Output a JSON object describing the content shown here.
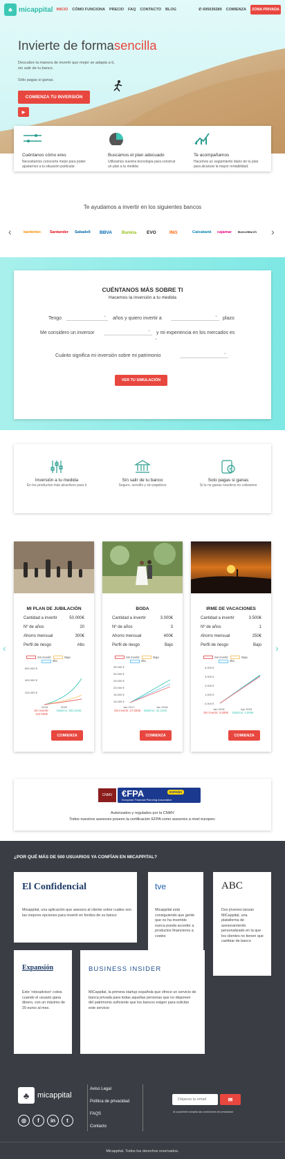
{
  "nav": {
    "logo": "micappital",
    "links": [
      "INICIO",
      "CÓMO FUNCIONA",
      "PRECIO",
      "FAQ",
      "CONTACTO",
      "BLOG"
    ],
    "phone": "695039289",
    "start": "COMIENZA",
    "private": "ZONA PRIVADA"
  },
  "hero": {
    "title_start": "Invierte de forma",
    "title_highlight": "sencilla",
    "subtitle": "Descubre la manera de invertir que mejor se adapta a ti, sin salir de tu banco.",
    "pay": "Sólo pagas si ganas.",
    "cta": "COMIENZA TU INVERSIÓN"
  },
  "features": [
    {
      "title": "Cuéntanos cómo eres",
      "text": "Necesitamos conocerte mejor para poder ajustarnos a tu situación particular."
    },
    {
      "title": "Buscamos el plan adecuado",
      "text": "Utilizamos nuestra tecnología para construir un plan a tu medida"
    },
    {
      "title": "Te acompañamos",
      "text": "Hacemos un seguimiento diario de tu plan para alcanzar la mayor rentabilidad."
    }
  ],
  "banks": {
    "title": "Te ayudamos a invertir en los siguientes bancos",
    "list": [
      "bankinter.",
      "Santander",
      "Sabadell",
      "BBVA",
      "Bankia",
      "EVO",
      "ING",
      "Caixabank",
      "cajamar",
      "BancoMarch"
    ]
  },
  "form": {
    "title": "CUÉNTANOS MÁS SOBRE TI",
    "subtitle": "Hacemos la inversión a tu medida",
    "row1_a": "Tengo",
    "row1_b": "años y quiero invertir a",
    "row1_c": "plazo",
    "row2_a": "Me considero un inversor",
    "row2_b": "y mi experiencia en los mercados es",
    "row3": "Cuánto significa mi inversión sobre mi patrimonio",
    "button": "VER TU SIMULACIÓN"
  },
  "benefits": [
    {
      "title": "Inversión a tu medida",
      "text": "En los productos más atractivos para ti"
    },
    {
      "title": "Sin salir de tu banco",
      "text": "Seguro, sencillo y sin papeleos"
    },
    {
      "title": "Solo pagas si ganas",
      "text": "Si tu no ganas nosotros no cobramos"
    }
  ],
  "plans": [
    {
      "title": "MI PLAN DE JUBILACIÓN",
      "rows": [
        [
          "Cantidad a invertir",
          "50.000€"
        ],
        [
          "Nº de años",
          "20"
        ],
        [
          "Ahorro mensual",
          "300€"
        ],
        [
          "Perfil de riesgo",
          "Alto"
        ]
      ],
      "legend": [
        "Sin invertir",
        "Baja",
        "alta"
      ],
      "ticks_y": [
        "600.000 €",
        "400.000 €",
        "200.000 €"
      ],
      "ticks_x": [
        "2018",
        "2029"
      ],
      "min": "Sin invertir: 122.000€",
      "max": "Máximo: 563.164€",
      "button": "COMIENZA"
    },
    {
      "title": "BODA",
      "rows": [
        [
          "Cantidad a invertir",
          "3.000€"
        ],
        [
          "Nº de años",
          "3"
        ],
        [
          "Ahorro mensual",
          "400€"
        ],
        [
          "Perfil de riesgo",
          "Bajo"
        ]
      ],
      "legend": [
        "Sin invertir",
        "Baja",
        "alta"
      ],
      "ticks_y": [
        "35.000 €",
        "30.000 €",
        "25.000 €",
        "20.000 €",
        "15.000 €",
        "10.000 €"
      ],
      "ticks_x": [
        "Jan 2017",
        "Jan 2018"
      ],
      "min": "Sin invertir: 27.000€",
      "max": "Máximo: 32.210€",
      "button": "COMIENZA"
    },
    {
      "title": "IRME DE VACACIONES",
      "rows": [
        [
          "Cantidad a invertir",
          "3.500€"
        ],
        [
          "Nº de años",
          "1"
        ],
        [
          "Ahorro mensual",
          "250€"
        ],
        [
          "Perfil de riesgo",
          "Bajo"
        ]
      ],
      "legend": [
        "Sin invertir",
        "Baja",
        "alta"
      ],
      "ticks_y": [
        "4.000 €",
        "3.000 €",
        "2.000 €",
        "1.000 €",
        "0.000 €"
      ],
      "ticks_x": [
        "Jan 2018",
        "Apr 2018"
      ],
      "min": "Sin invertir: 3.500€",
      "max": "Máximo: 3.600€",
      "button": "COMIENZA"
    }
  ],
  "efpa": {
    "cnmv": "CNMV",
    "logo": "€FPA",
    "espana": "ESPAÑA",
    "assoc": "European Financial Planning Association",
    "line1": "Autorizados y regulados por la CNMV",
    "line2": "Todos nuestros asesores poseen la certificación EFPA como asesores a nivel europeo."
  },
  "press": {
    "title": "¿POR QUÉ MÁS DE 500 USUARIOS YA CONFÍAN EN MICAPPITAL?",
    "items": [
      {
        "name": "El Confidencial",
        "text": "Micappital, una aplicación que asesora al cliente sobre cuáles son las mejores opciones para invertir en fondos de su banco"
      },
      {
        "name": "tve",
        "text": "Micappital está consiguiendo que gente que no ha invertido nunca pueda acceder a productos financieros a costes"
      },
      {
        "name": "ABC",
        "text": "Dos jóvenes lanzan MiCappital, una plataforma de asesoramiento personalizado en la que los clientes no tienen que cambiar de banco"
      },
      {
        "name": "Expansión",
        "text": "Este 'roboadvisor' cobra cuando el usuario gana dinero, con un máximo de 20 euros al mes."
      },
      {
        "name": "BUSINESS INSIDER",
        "text": "MiCappital, la primera startup española que ofrece un servicio de banca privada para todas aquellas personas que no disponen del patrimonio suficiente que los bancos exigen para solicitar este servicio"
      }
    ]
  },
  "footer": {
    "logo": "micappital",
    "links": [
      "Aviso Legal",
      "Política de privacidad",
      "FAQS",
      "Contacto"
    ],
    "email_placeholder": "Déjanos tu email",
    "terms": "Al suscribirte aceptas las condiciones de privacidad",
    "copyright": "Micappital. Todos los derechos reservados."
  },
  "colors": {
    "accent": "#e8473f",
    "teal": "#3cc7b5",
    "dark": "#3a3d44"
  }
}
